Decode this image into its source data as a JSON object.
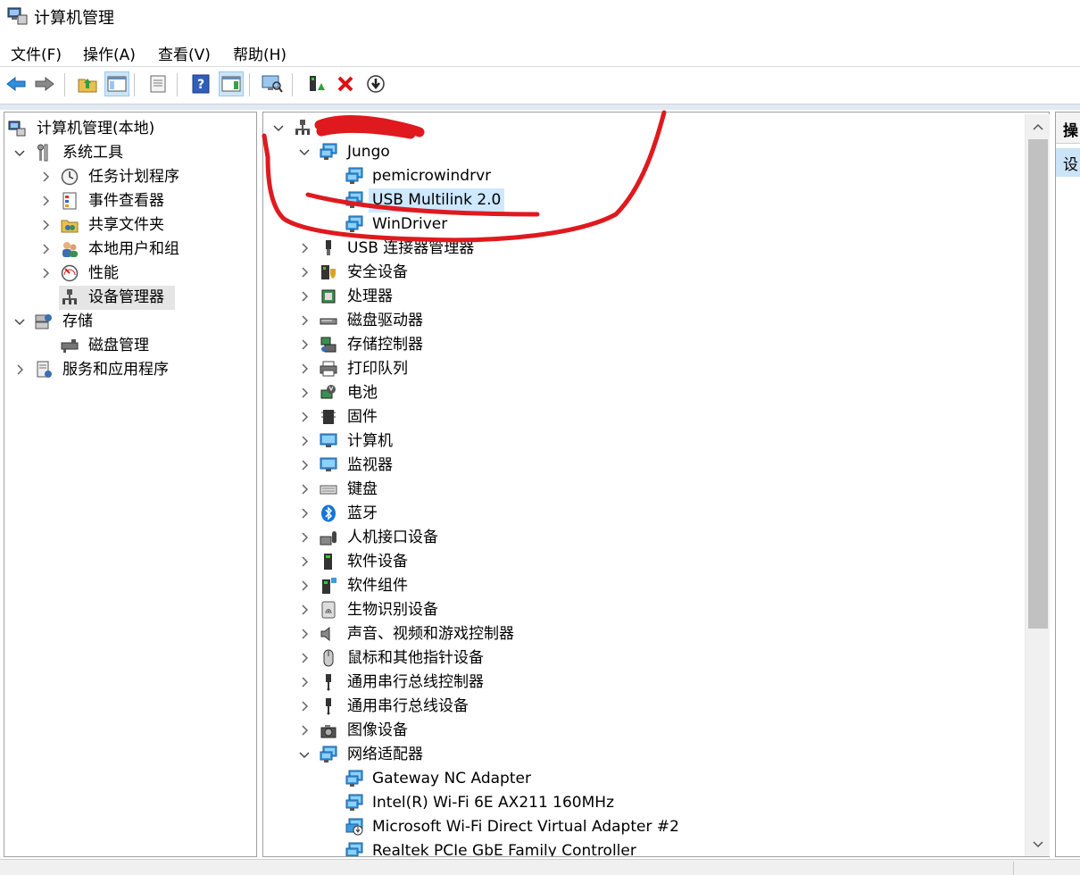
{
  "window": {
    "title": "计算机管理"
  },
  "menu": [
    "文件(F)",
    "操作(A)",
    "查看(V)",
    "帮助(H)"
  ],
  "toolbar_icons": [
    "back-arrow-icon",
    "forward-arrow-icon",
    "up-folder-icon",
    "show-hide-console-tree-icon",
    "properties-icon",
    "help-icon",
    "show-action-pane-icon",
    "scan-hardware-icon",
    "update-driver-icon",
    "uninstall-x-icon",
    "disable-device-icon"
  ],
  "tree": {
    "root": "计算机管理(本地)",
    "system_tools": "系统工具",
    "task_scheduler": "任务计划程序",
    "event_viewer": "事件查看器",
    "shared_folders": "共享文件夹",
    "local_users": "本地用户和组",
    "performance": "性能",
    "device_manager": "设备管理器",
    "storage": "存储",
    "disk_management": "磁盘管理",
    "services_apps": "服务和应用程序"
  },
  "devices": {
    "computer_node": "",
    "jungo": "Jungo",
    "jungo_children": [
      "pemicrowindrvr",
      "USB Multilink 2.0",
      "WinDriver"
    ],
    "categories": [
      "USB 连接器管理器",
      "安全设备",
      "处理器",
      "磁盘驱动器",
      "存储控制器",
      "打印队列",
      "电池",
      "固件",
      "计算机",
      "监视器",
      "键盘",
      "蓝牙",
      "人机接口设备",
      "软件设备",
      "软件组件",
      "生物识别设备",
      "声音、视频和游戏控制器",
      "鼠标和其他指针设备",
      "通用串行总线控制器",
      "通用串行总线设备",
      "图像设备",
      "网络适配器"
    ],
    "network_children": [
      "Gateway NC Adapter",
      "Intel(R) Wi-Fi 6E AX211 160MHz",
      "Microsoft Wi-Fi Direct Virtual Adapter #2",
      "Realtek PCIe GbE Family Controller"
    ]
  },
  "actions_pane": {
    "header": "操",
    "item": "设"
  },
  "annotation_color": "#e0191e"
}
